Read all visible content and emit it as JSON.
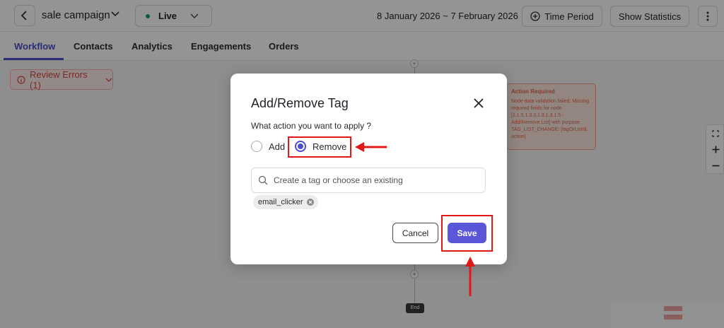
{
  "header": {
    "campaign_name": "sale campaign",
    "status_label": "Live",
    "status_color": "#1d9a6c",
    "date_range": "8 January 2026 ~ 7 February 2026",
    "time_period_label": "Time Period",
    "show_statistics_label": "Show Statistics"
  },
  "tabs": [
    {
      "label": "Workflow",
      "active": true
    },
    {
      "label": "Contacts",
      "active": false
    },
    {
      "label": "Analytics",
      "active": false
    },
    {
      "label": "Engagements",
      "active": false
    },
    {
      "label": "Orders",
      "active": false
    }
  ],
  "canvas": {
    "review_errors_label": "Review Errors (1)",
    "plus_symbol": "+",
    "end_label": "End",
    "action_required": {
      "title": "Action Required",
      "message": "Node data validation failed: Missing required fields for node [1.1.5.1.3.3.1.3.1.3.1.5 - Add/Remove List] with purpose TAG_LIST_CHANGE: [tagOrListId, action]"
    }
  },
  "modal": {
    "title": "Add/Remove Tag",
    "question": "What action you want to apply ?",
    "options": [
      {
        "label": "Add",
        "checked": false
      },
      {
        "label": "Remove",
        "checked": true
      }
    ],
    "search_placeholder": "Create a tag or choose an existing",
    "tags": [
      "email_clicker"
    ],
    "cancel_label": "Cancel",
    "save_label": "Save"
  },
  "colors": {
    "accent": "#4b4fc9",
    "save_button": "#5a56d8",
    "annotation_red": "#e01818"
  }
}
